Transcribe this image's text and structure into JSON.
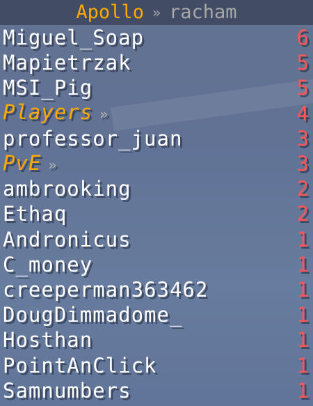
{
  "colors": {
    "header_title": "#ffaa00",
    "header_server": "#a8a8a8",
    "player_name": "#ffffff",
    "team_name": "#ffaa00",
    "score": "#ff5555"
  },
  "header": {
    "title": "Apollo",
    "separator": "»",
    "server": "racham"
  },
  "rows": [
    {
      "name": "Miguel_Soap",
      "score": "6",
      "kind": "player"
    },
    {
      "name": "Mapietrzak",
      "score": "5",
      "kind": "player"
    },
    {
      "name": "MSI_Pig",
      "score": "5",
      "kind": "player"
    },
    {
      "name": "Players",
      "suffix": "»",
      "score": "4",
      "kind": "team"
    },
    {
      "name": "professor_juan",
      "score": "3",
      "kind": "player"
    },
    {
      "name": "PvE",
      "suffix": "»",
      "score": "3",
      "kind": "team"
    },
    {
      "name": "ambrooking",
      "score": "2",
      "kind": "player"
    },
    {
      "name": "Ethaq",
      "score": "2",
      "kind": "player"
    },
    {
      "name": "Andronicus",
      "score": "1",
      "kind": "player"
    },
    {
      "name": "C_money",
      "score": "1",
      "kind": "player"
    },
    {
      "name": "creeperman363462",
      "score": "1",
      "kind": "player"
    },
    {
      "name": "DougDimmadome_",
      "score": "1",
      "kind": "player"
    },
    {
      "name": "Hosthan",
      "score": "1",
      "kind": "player"
    },
    {
      "name": "PointAnClick",
      "score": "1",
      "kind": "player"
    },
    {
      "name": "Samnumbers",
      "score": "1",
      "kind": "player"
    }
  ]
}
